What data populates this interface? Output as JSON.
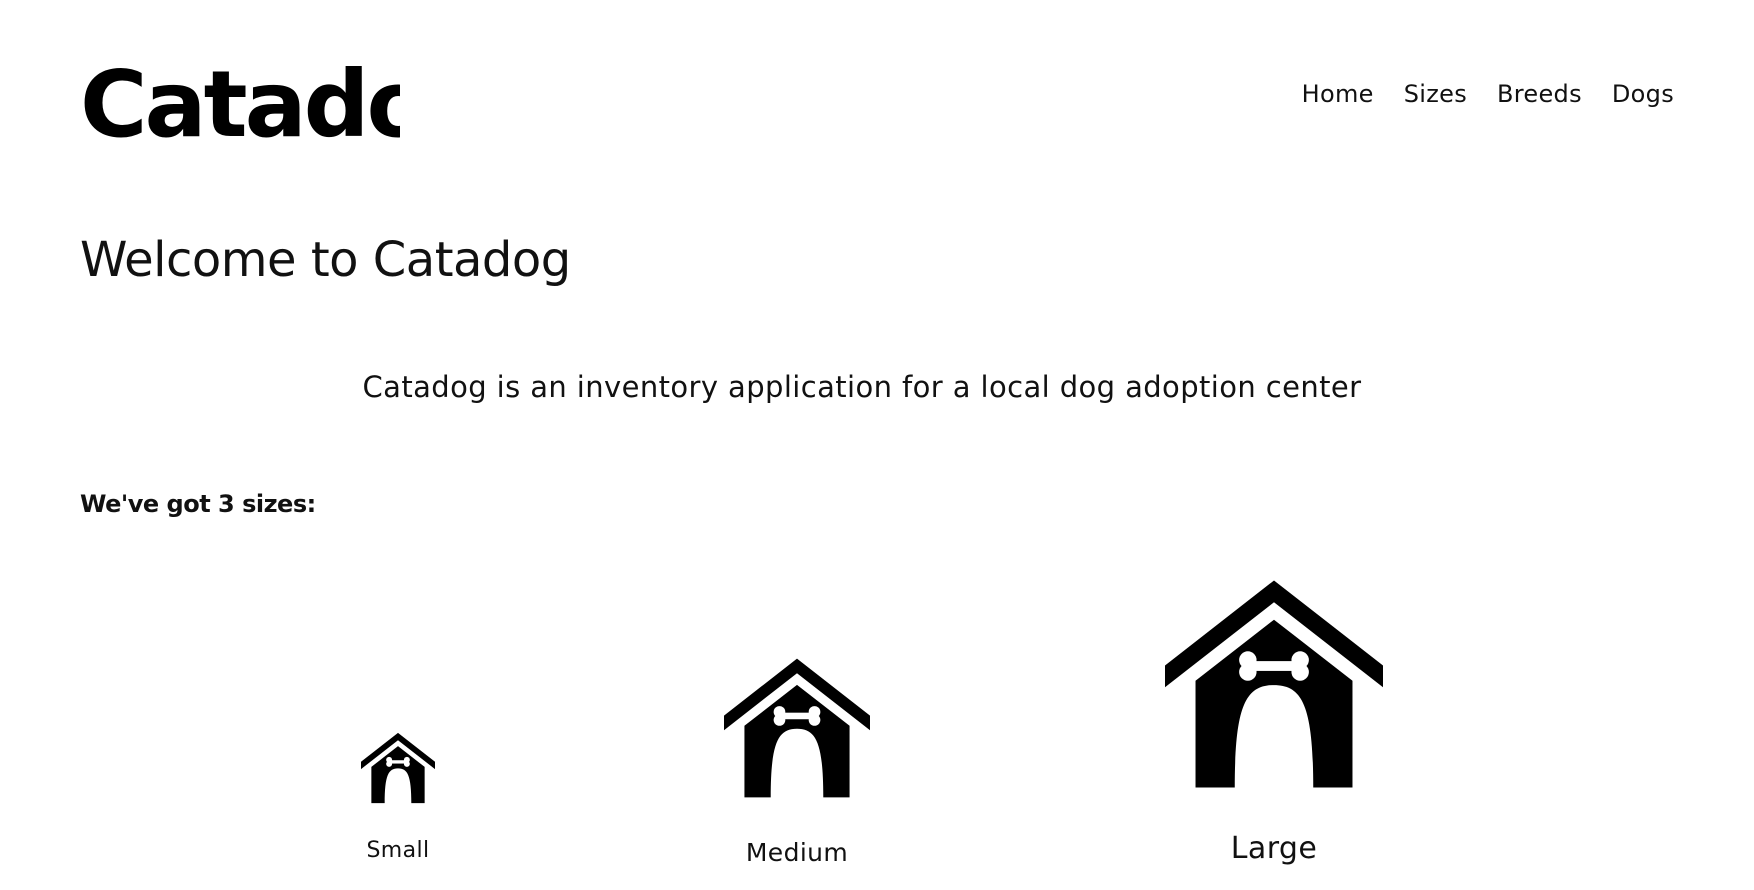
{
  "header": {
    "logo_text": "Catadog",
    "nav": [
      {
        "label": "Home"
      },
      {
        "label": "Sizes"
      },
      {
        "label": "Breeds"
      },
      {
        "label": "Dogs"
      }
    ]
  },
  "main": {
    "title": "Welcome to Catadog",
    "intro": "Catadog is an inventory application for a local dog adoption center",
    "sizes_heading": "We've got 3 sizes:",
    "sizes": [
      {
        "label": "Small",
        "icon": "doghouse-icon"
      },
      {
        "label": "Medium",
        "icon": "doghouse-icon"
      },
      {
        "label": "Large",
        "icon": "doghouse-icon"
      }
    ]
  },
  "colors": {
    "text": "#111111",
    "background": "#ffffff"
  }
}
